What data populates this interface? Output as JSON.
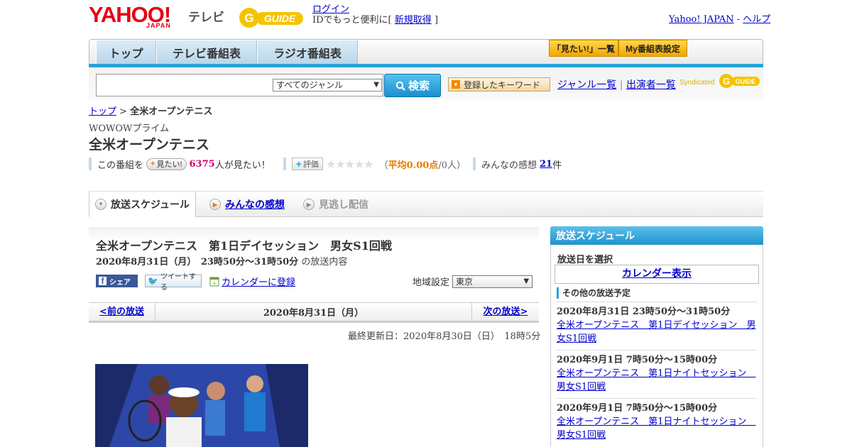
{
  "header": {
    "brand": "YAHOO!",
    "brand_sub": "JAPAN",
    "brand_tv": "テレビ",
    "gguide": "G GUIDE",
    "login": "ログイン",
    "login_note": "IDでもっと便利に[",
    "signup": "新規取得",
    "login_note_end": "]",
    "yahoo_japan_link": "Yahoo! JAPAN",
    "help_link": "ヘルプ"
  },
  "nav": {
    "tabs": [
      "トップ",
      "テレビ番組表",
      "ラジオ番組表"
    ],
    "mitai_list": "「見たい!」一覧",
    "my_schedule": "My番組表設定"
  },
  "search": {
    "placeholder": "",
    "genre_selected": "すべてのジャンル",
    "button": "検索",
    "keyword_button": "登録したキーワード",
    "genre_list": "ジャンル一覧",
    "performer_list": "出演者一覧",
    "syndicated": "Syndicated"
  },
  "breadcrumb": {
    "home": "トップ",
    "sep": ">",
    "current": "全米オープンテニス"
  },
  "program": {
    "channel": "WOWOWプライム",
    "title": "全米オープンテニス",
    "this_program": "この番組を",
    "mitai_pill": "見たい!",
    "mitai_count": "6375",
    "mitai_suffix": "人が見たい！",
    "rate_btn": "評価",
    "avg_open": "（",
    "avg_label": "平均0.00点",
    "avg_rest": "/0人）",
    "impressions_label": "みんなの感想",
    "impressions_count": "21",
    "impressions_unit": "件"
  },
  "tabs": {
    "schedule": "放送スケジュール",
    "impressions": "みんなの感想",
    "missed": "見逃し配信"
  },
  "episode": {
    "title": "全米オープンテニス　第1日デイセッション　男女S1回戦",
    "datetime": "2020年8月31日（月）　23時50分～31時50分",
    "datetime_suffix": "の放送内容",
    "share": "シェア",
    "tweet": "ツイートする",
    "calendar": "カレンダーに登録",
    "region_label": "地域設定",
    "region_value": "東京",
    "prev": "<前の放送",
    "date": "2020年8月31日（月）",
    "next": "次の放送>",
    "updated": "最終更新日：2020年8月30日（日）　18時5分"
  },
  "sidebar": {
    "header": "放送スケジュール",
    "pick_date": "放送日を選択",
    "calendar_btn": "カレンダー表示",
    "other_label": "その他の放送予定",
    "items": [
      {
        "date": "2020年8月31日  23時50分～31時50分",
        "title": "全米オープンテニス　第1日デイセッション　男女S1回戦"
      },
      {
        "date": "2020年9月1日  7時50分～15時00分",
        "title": "全米オープンテニス　第1日ナイトセッション　男女S1回戦"
      },
      {
        "date": "2020年9月1日  7時50分～15時00分",
        "title": "全米オープンテニス　第1日ナイトセッション　男女S1回戦"
      }
    ]
  },
  "colors": {
    "accent_blue": "#28a3d8",
    "brand_red": "#e60012",
    "pink": "#d6006b",
    "orange": "#e87b00"
  }
}
